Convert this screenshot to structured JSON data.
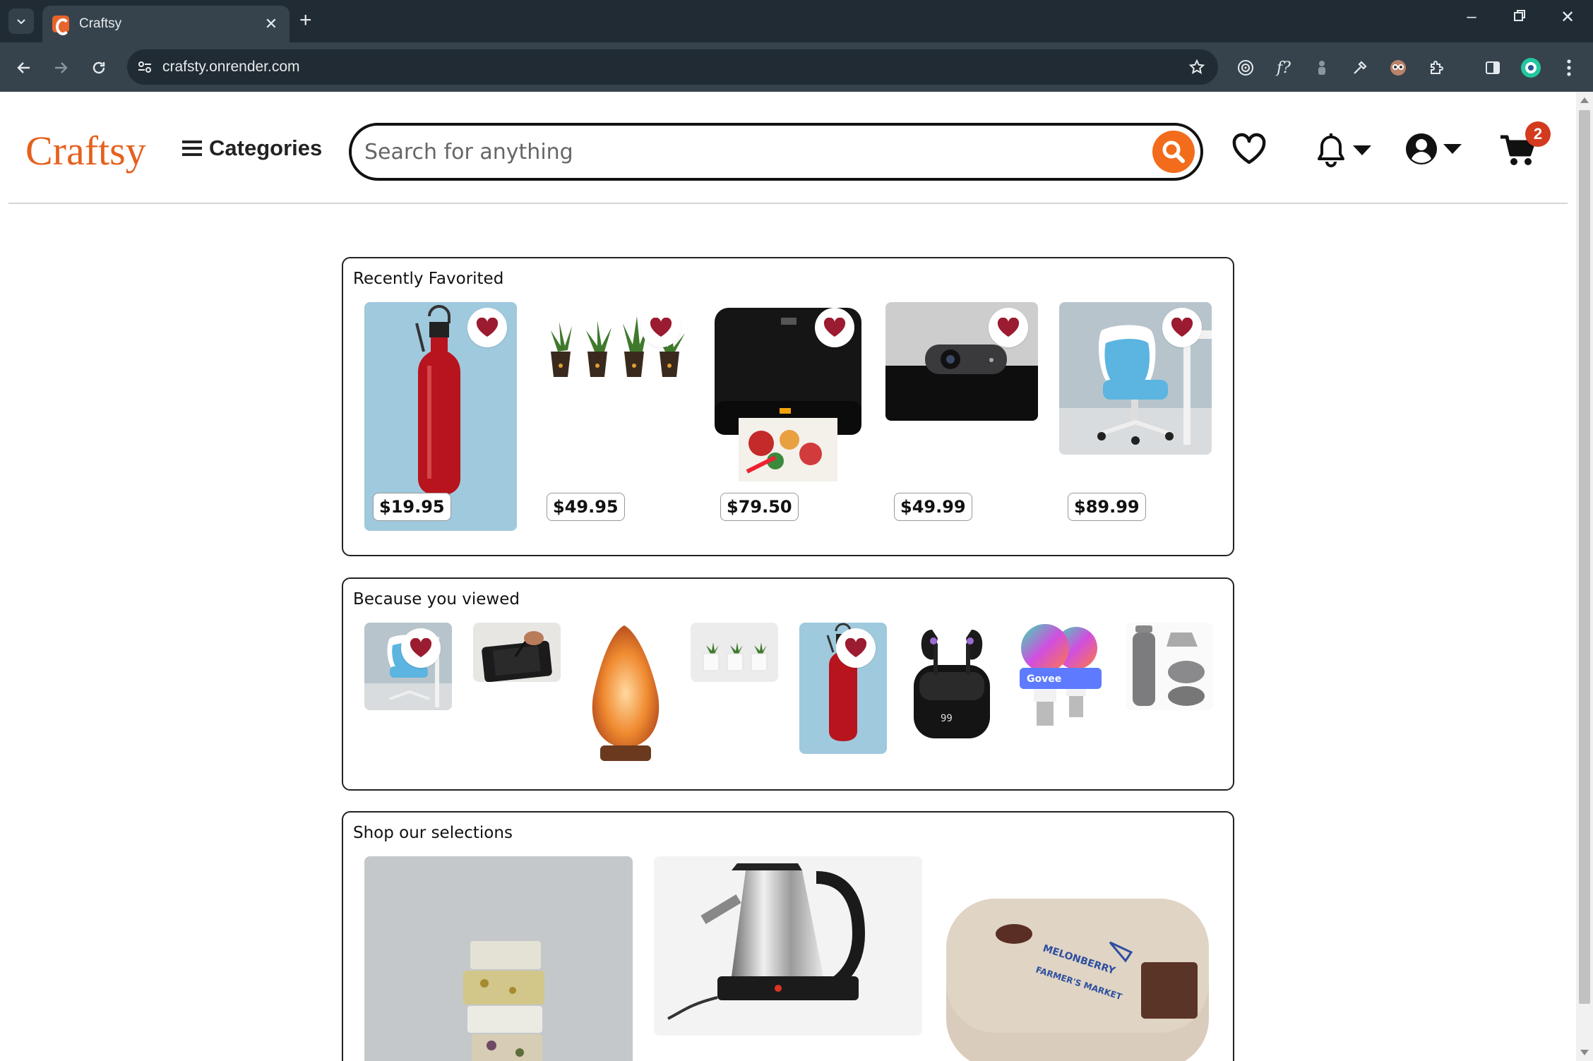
{
  "browser": {
    "tab_title": "Craftsy",
    "url": "crafsty.onrender.com"
  },
  "header": {
    "logo": "Craftsy",
    "categories_label": "Categories",
    "search_placeholder": "Search for anything",
    "cart_count": "2"
  },
  "recently_favorited": {
    "title": "Recently Favorited",
    "items": [
      {
        "image": "red-water-bottle",
        "price": "$19.95",
        "favorited": true
      },
      {
        "image": "potted-plants",
        "price": "$49.95",
        "favorited": true
      },
      {
        "image": "photo-printer",
        "price": "$79.50",
        "favorited": true
      },
      {
        "image": "webcam",
        "price": "$49.99",
        "favorited": true
      },
      {
        "image": "office-chair",
        "price": "$89.99",
        "favorited": true
      }
    ]
  },
  "because_viewed": {
    "title": "Because you viewed",
    "items": [
      {
        "image": "office-chair",
        "favorited": true
      },
      {
        "image": "drawing-tablet",
        "favorited": false
      },
      {
        "image": "salt-lamp",
        "favorited": false
      },
      {
        "image": "white-planters",
        "favorited": false
      },
      {
        "image": "red-water-bottle",
        "favorited": true
      },
      {
        "image": "wireless-earbuds",
        "favorited": false
      },
      {
        "image": "smart-bulbs",
        "favorited": false
      },
      {
        "image": "collapsible-bottle",
        "favorited": false
      }
    ],
    "bulb_brand": "Govee"
  },
  "selections": {
    "title": "Shop our selections",
    "items": [
      {
        "image": "handmade-soap-stack"
      },
      {
        "image": "electric-kettle"
      },
      {
        "image": "lunch-box",
        "printed_text": [
          "MELONBERRY",
          "FARMER'S MARKET"
        ]
      }
    ]
  },
  "colors": {
    "brand": "#e5611e",
    "heart": "#9b1b30",
    "badge": "#d33a1e"
  }
}
